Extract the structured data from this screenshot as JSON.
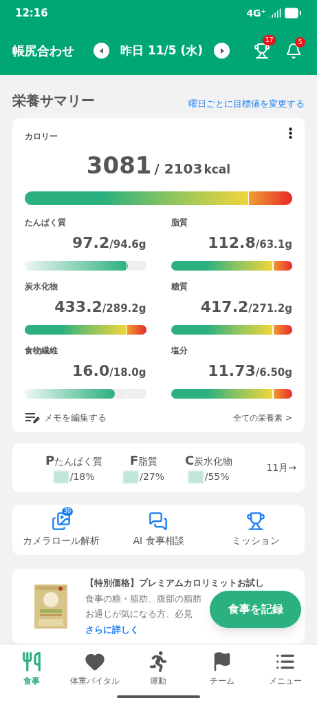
{
  "status_bar": {
    "time": "12:16",
    "network": "4G⁺"
  },
  "header": {
    "title": "帳尻合わせ",
    "date": "昨日 11/5 (水)",
    "trophy_badge": "17",
    "bell_badge": "5"
  },
  "summary": {
    "title": "栄養サマリー",
    "link": "曜日ごとに目標値を変更する"
  },
  "calorie": {
    "label": "カロリー",
    "value": "3081",
    "target": "/ 2103",
    "unit": "kcal",
    "level": 1,
    "over": true
  },
  "nutrients": [
    {
      "label": "たんぱく質",
      "value": "97.2",
      "target": "/94.6g",
      "level": 0.85,
      "over": false
    },
    {
      "label": "脂質",
      "value": "112.8",
      "target": "/63.1g",
      "level": 1,
      "over": true
    },
    {
      "label": "炭水化物",
      "value": "433.2",
      "target": "/289.2g",
      "level": 1,
      "over": true
    },
    {
      "label": "糖質",
      "value": "417.2",
      "target": "/271.2g",
      "level": 1,
      "over": true
    },
    {
      "label": "食物繊維",
      "value": "16.0",
      "target": "/18.0g",
      "level": 0.74,
      "over": false
    },
    {
      "label": "塩分",
      "value": "11.73",
      "target": "/6.50g",
      "level": 1,
      "over": true
    }
  ],
  "memo_link": "メモを編集する",
  "all_link": "全ての栄養素 >",
  "pfc": {
    "items": [
      {
        "letter": "P",
        "label": "たんぱく質",
        "ratio": "/18%"
      },
      {
        "letter": "F",
        "label": "脂質",
        "ratio": "/27%"
      },
      {
        "letter": "C",
        "label": "炭水化物",
        "ratio": "/55%"
      }
    ],
    "month_link": "11月→"
  },
  "actions": [
    {
      "kind": "photos",
      "label": "カメラロール解析",
      "badge": "30"
    },
    {
      "kind": "chat",
      "label": "AI 食事相談"
    },
    {
      "kind": "trophy",
      "label": "ミッション"
    }
  ],
  "ad": {
    "title": "【特別価格】プレミアムカロリミットお試し",
    "line_1": "食事の糖・脂肪、腹部の脂肪",
    "line_2": "お通じが気になる方、必見",
    "link": "さらに詳しく"
  },
  "fab": "食事を記録",
  "nav": [
    {
      "kind": "meal",
      "label": "食事",
      "selected": true
    },
    {
      "kind": "vital",
      "label": "体重バイタル",
      "selected": false
    },
    {
      "kind": "run",
      "label": "運動",
      "selected": false
    },
    {
      "kind": "team",
      "label": "チーム",
      "selected": false
    },
    {
      "kind": "menu",
      "label": "メニュー",
      "selected": false
    }
  ]
}
